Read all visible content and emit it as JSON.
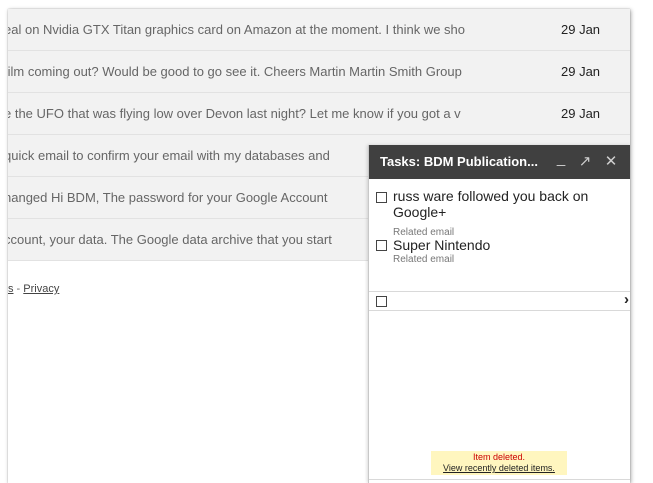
{
  "emails": [
    {
      "snippet": "eal on Nvidia GTX Titan graphics card on Amazon at the moment. I think we sho",
      "date": "29 Jan"
    },
    {
      "snippet": "film coming out? Would be good to go see it. Cheers Martin Martin Smith Group",
      "date": "29 Jan"
    },
    {
      "snippet": "e the UFO that was flying low over Devon last night? Let me know if you got a v",
      "date": "29 Jan"
    },
    {
      "snippet": "quick email to confirm your email with my databases and",
      "date": ""
    },
    {
      "snippet": "hanged Hi BDM, The password for your Google Account",
      "date": ""
    },
    {
      "snippet": "ccount, your data. The Google data archive that you start",
      "date": ""
    }
  ],
  "footer": {
    "terms_fragment": "s",
    "separator": " - ",
    "privacy": "Privacy"
  },
  "tasks": {
    "title": "Tasks: BDM Publication...",
    "minimize_label": "_",
    "popout_label": "↗",
    "close_label": "✕",
    "items": [
      {
        "title": "russ ware followed you back on Google+",
        "related": "Related email"
      },
      {
        "title": "Super Nintendo",
        "related": "Related email"
      }
    ],
    "new_task_arrow": "›",
    "notice": {
      "message": "Item deleted.",
      "link": "View recently deleted items."
    }
  }
}
